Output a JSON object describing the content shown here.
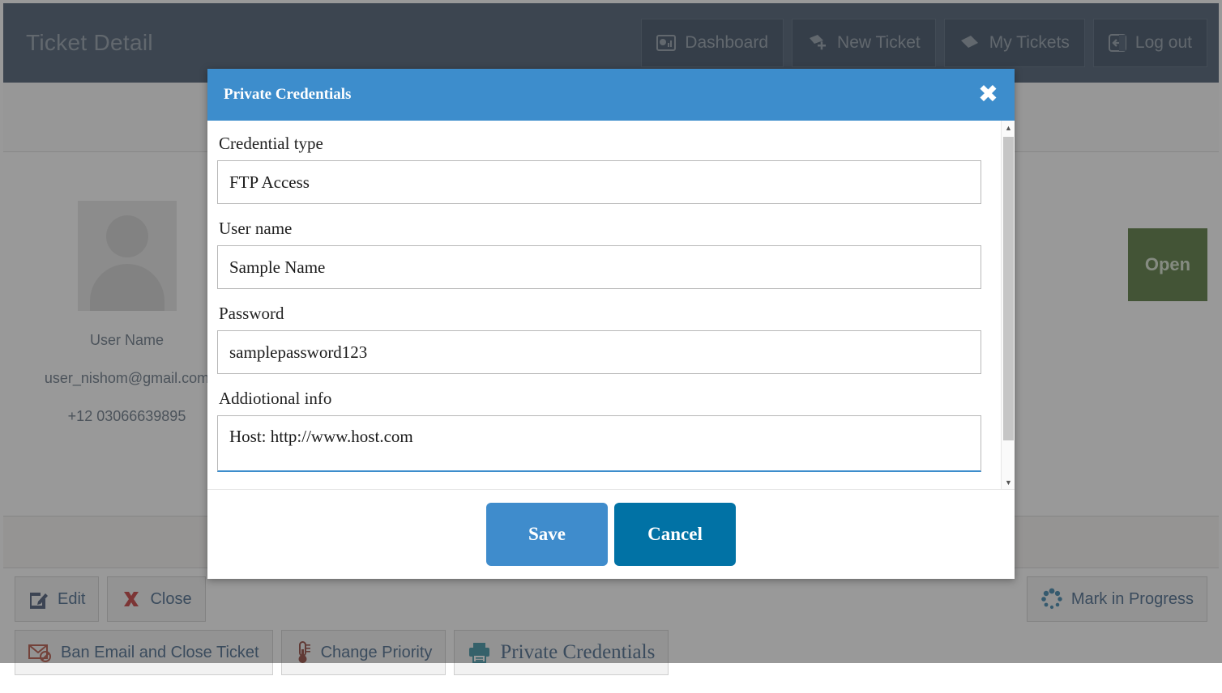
{
  "header": {
    "title": "Ticket Detail",
    "nav": [
      {
        "label": "Dashboard",
        "icon": "dashboard-icon"
      },
      {
        "label": "New Ticket",
        "icon": "ticket-plus-icon"
      },
      {
        "label": "My Tickets",
        "icon": "ticket-icon"
      },
      {
        "label": "Log out",
        "icon": "logout-icon"
      }
    ]
  },
  "ticket": {
    "user_name": "User Name",
    "user_email": "user_nishom@gmail.com",
    "user_phone": "+12 03066639895",
    "status": "Open",
    "status_color": "#4b7031"
  },
  "actions": {
    "row1": [
      {
        "label": "Edit",
        "icon": "edit-icon"
      },
      {
        "label": "Close",
        "icon": "x-icon"
      },
      {
        "label": "Mark in Progress",
        "icon": "spinner-icon"
      }
    ],
    "row2": [
      {
        "label": "Ban Email and Close Ticket",
        "icon": "banned-email-icon"
      },
      {
        "label": "Change Priority",
        "icon": "thermometer-icon"
      },
      {
        "label": "Private Credentials",
        "icon": "printer-icon"
      }
    ]
  },
  "modal": {
    "title": "Private Credentials",
    "close_label": "✖",
    "fields": [
      {
        "label": "Credential type",
        "value": "FTP Access"
      },
      {
        "label": "User name",
        "value": "Sample Name"
      },
      {
        "label": "Password",
        "value": "samplepassword123"
      },
      {
        "label": "Addiotional info",
        "value": "Host: http://www.host.com"
      }
    ],
    "save_label": "Save",
    "cancel_label": "Cancel",
    "accent_color": "#3d8dcc",
    "cancel_color": "#0172a5"
  }
}
